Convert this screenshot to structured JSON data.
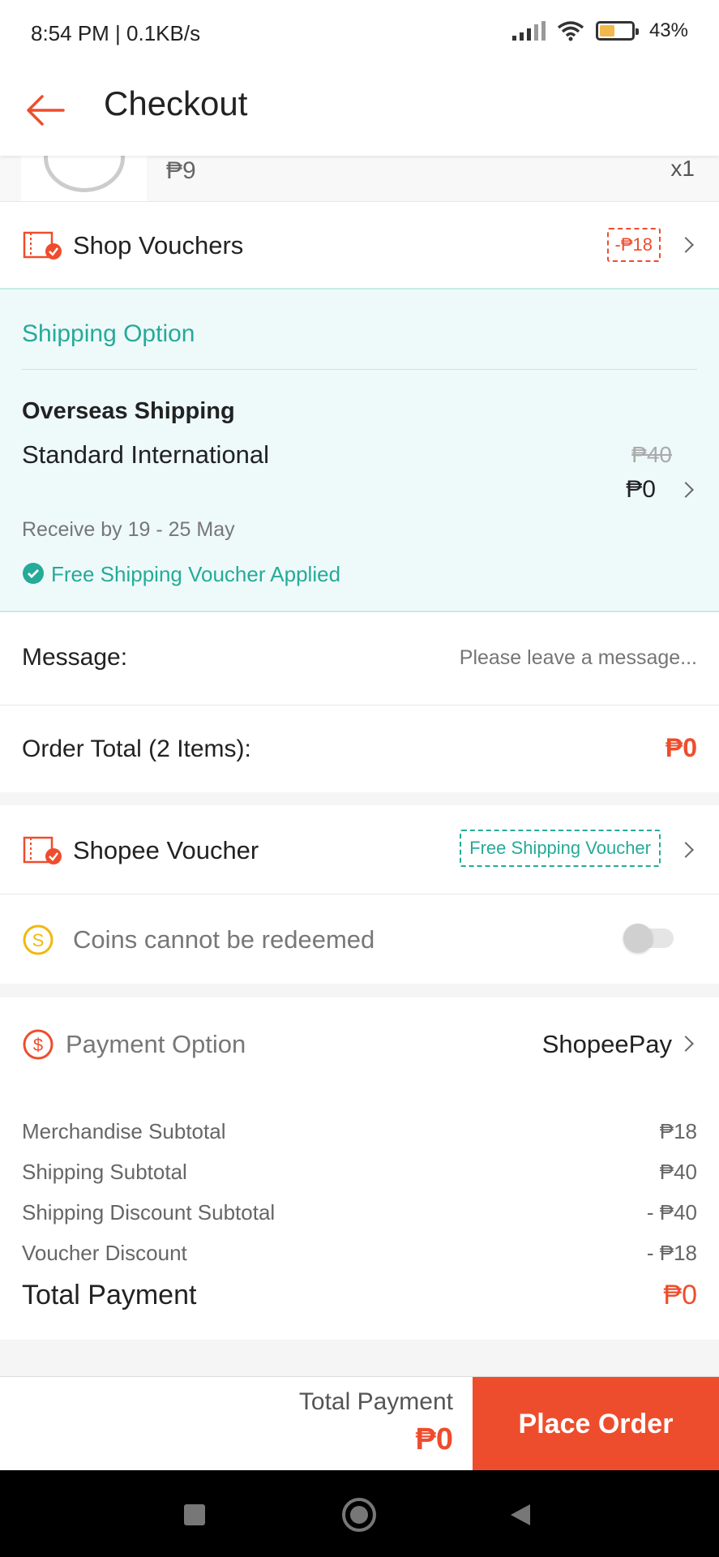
{
  "status_bar": {
    "time": "8:54 PM | 0.1KB/s",
    "battery": "43%"
  },
  "header": {
    "title": "Checkout"
  },
  "product": {
    "price": "₱9",
    "qty": "x1"
  },
  "shop_vouchers": {
    "label": "Shop Vouchers",
    "tag": "-₱18"
  },
  "shipping": {
    "section_title": "Shipping Option",
    "method": "Overseas Shipping",
    "service": "Standard International",
    "original_price": "₱40",
    "price": "₱0",
    "receive": "Receive by 19 - 25 May",
    "voucher_applied": "Free Shipping Voucher Applied"
  },
  "message": {
    "label": "Message:",
    "placeholder": "Please leave a message..."
  },
  "order_total": {
    "label": "Order Total (2 Items):",
    "value": "₱0"
  },
  "shopee_voucher": {
    "label": "Shopee Voucher",
    "tag": "Free Shipping Voucher"
  },
  "coins": {
    "label": "Coins cannot be redeemed",
    "toggle_on": false
  },
  "payment": {
    "label": "Payment Option",
    "method": "ShopeePay"
  },
  "summary": {
    "rows": [
      {
        "label": "Merchandise Subtotal",
        "value": "₱18"
      },
      {
        "label": "Shipping Subtotal",
        "value": "₱40"
      },
      {
        "label": "Shipping Discount Subtotal",
        "value": "- ₱40"
      },
      {
        "label": "Voucher Discount",
        "value": "- ₱18"
      }
    ],
    "total_label": "Total Payment",
    "total_value": "₱0"
  },
  "bottom_bar": {
    "total_label": "Total Payment",
    "total_value": "₱0",
    "button": "Place Order"
  },
  "colors": {
    "accent": "#ee4d2d",
    "teal": "#26aa99",
    "shipping_bg": "#eefafa"
  }
}
